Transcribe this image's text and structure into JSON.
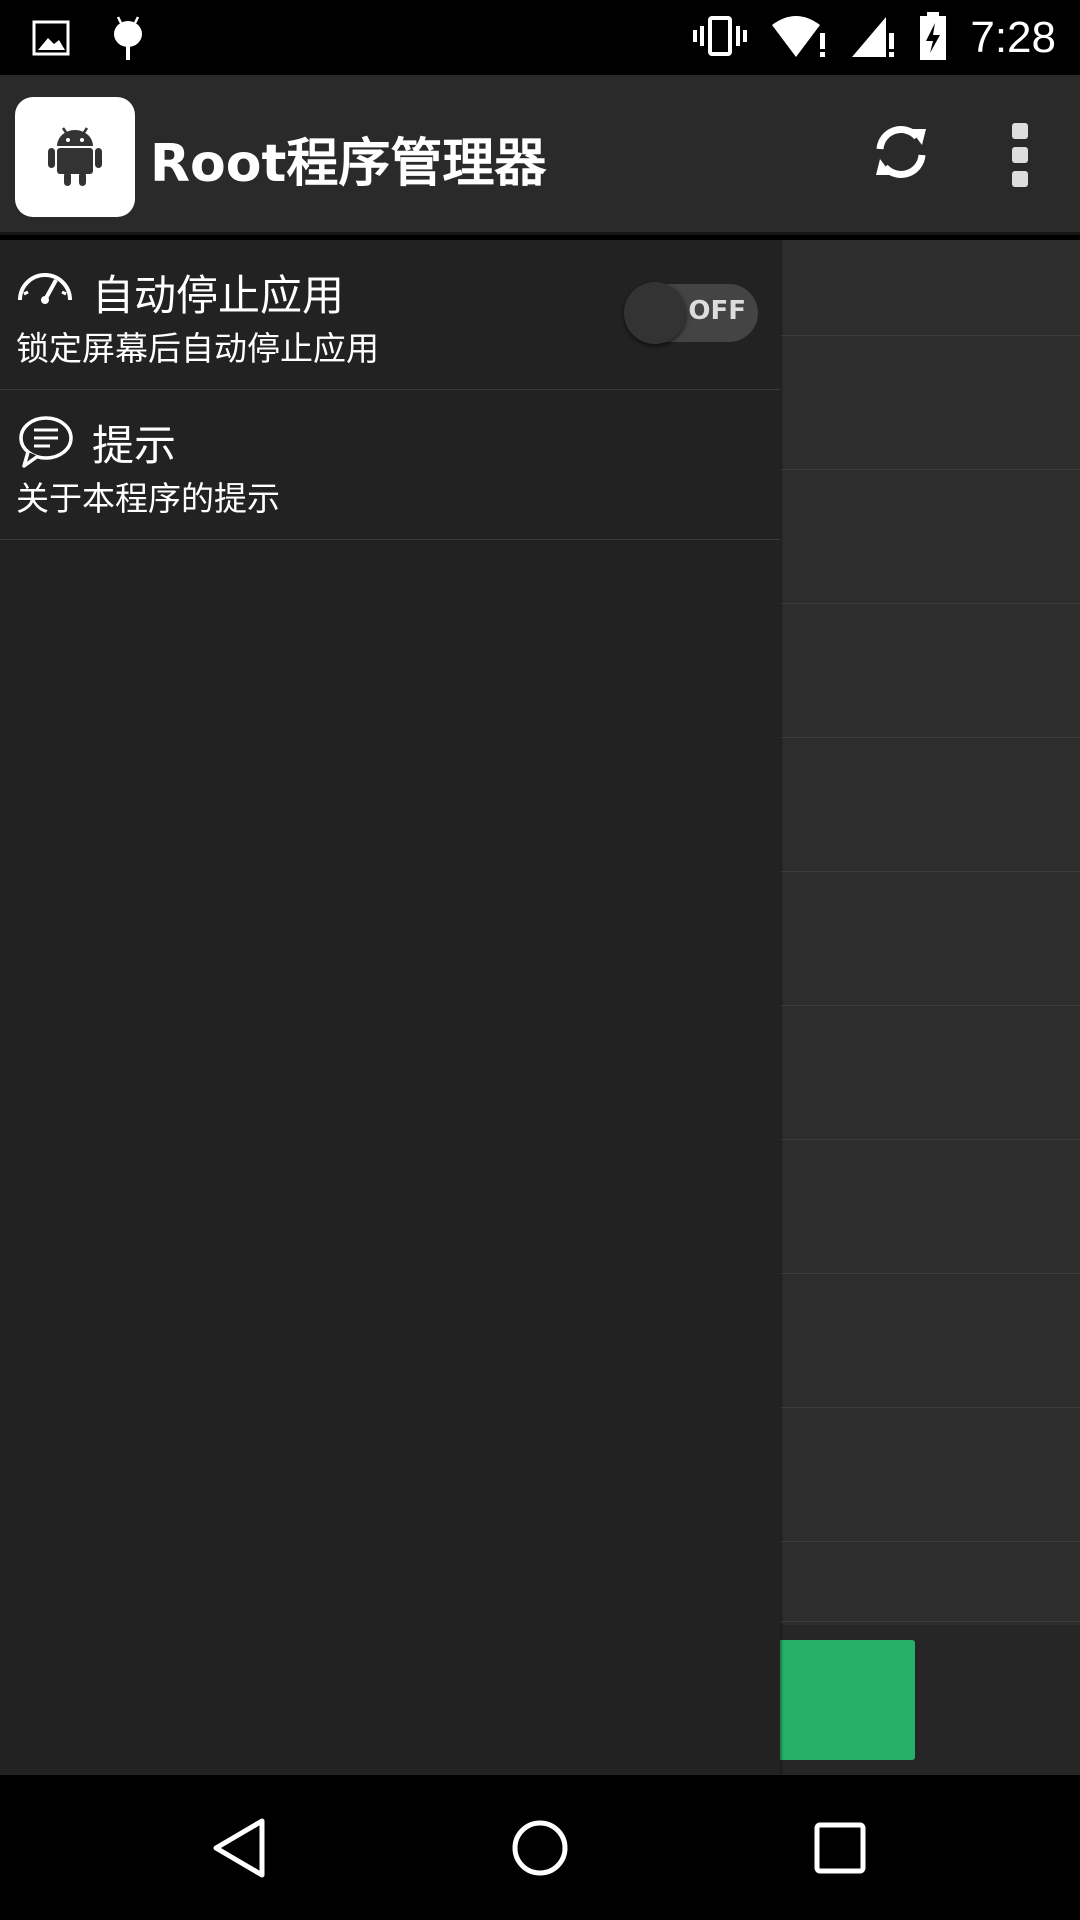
{
  "status_bar": {
    "time": "7:28",
    "left_icons": [
      "image-icon",
      "android-debug-icon"
    ],
    "right_icons": [
      "vibrate-icon",
      "wifi-warning-icon",
      "signal-warning-icon",
      "battery-charging-icon"
    ]
  },
  "action_bar": {
    "title": "Root程序管理器",
    "app_icon": "android-icon",
    "actions": [
      "refresh-icon",
      "overflow-menu-icon"
    ]
  },
  "drawer": {
    "items": [
      {
        "title": "自动停止应用",
        "subtitle": "锁定屏幕后自动停止应用",
        "icon": "speedometer-icon",
        "toggle": {
          "state_label": "OFF",
          "on": false
        }
      },
      {
        "title": "提示",
        "subtitle": "关于本程序的提示",
        "icon": "speech-bubble-icon"
      }
    ]
  },
  "colors": {
    "action_bar_bg": "#2a2a2a",
    "drawer_bg": "#222222",
    "content_bg": "#2d2d2d",
    "accent_green": "#27b067"
  },
  "nav_bar": {
    "buttons": [
      "back-icon",
      "home-icon",
      "recents-icon"
    ]
  }
}
